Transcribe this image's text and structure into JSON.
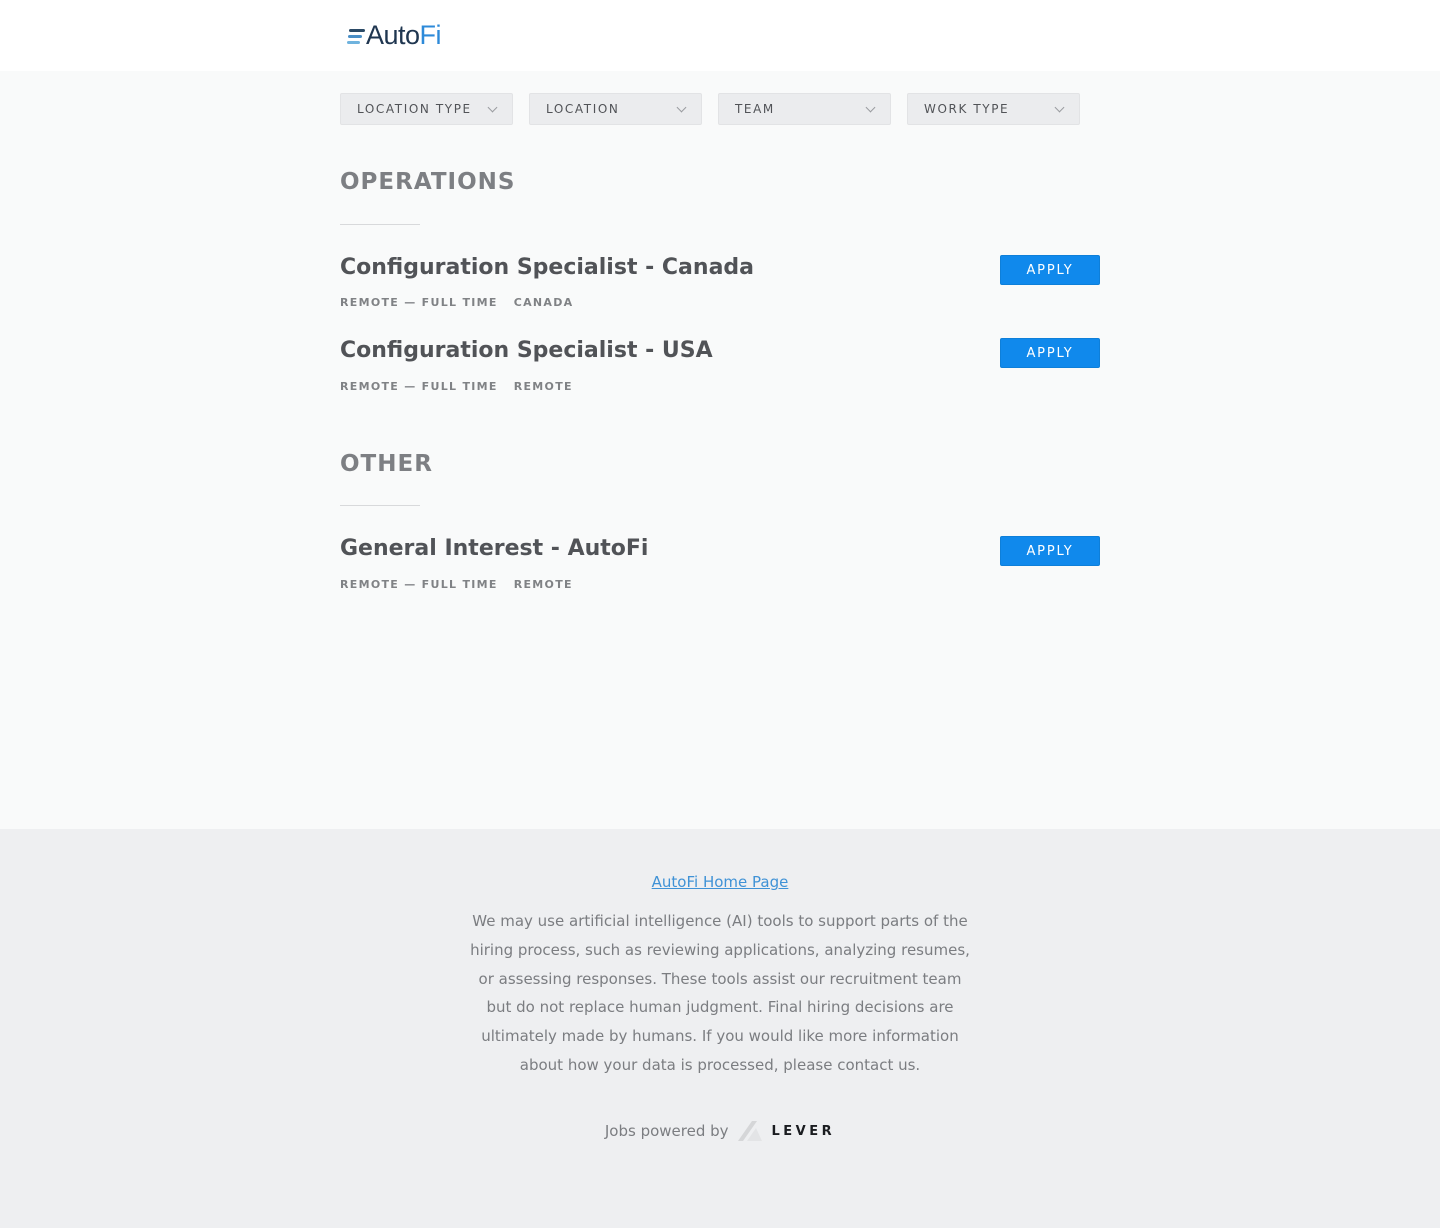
{
  "header": {
    "logo_part1": "Auto",
    "logo_part2": "Fi"
  },
  "filters": [
    {
      "label": "LOCATION TYPE"
    },
    {
      "label": "LOCATION"
    },
    {
      "label": "TEAM"
    },
    {
      "label": "WORK TYPE"
    }
  ],
  "groups": [
    {
      "title": "OPERATIONS",
      "postings": [
        {
          "title": "Configuration Specialist - Canada",
          "commitment": "REMOTE — FULL TIME",
          "location": "CANADA",
          "apply_label": "APPLY"
        },
        {
          "title": "Configuration Specialist - USA",
          "commitment": "REMOTE — FULL TIME",
          "location": "REMOTE",
          "apply_label": "APPLY"
        }
      ]
    },
    {
      "title": "OTHER",
      "postings": [
        {
          "title": "General Interest - AutoFi",
          "commitment": "REMOTE — FULL TIME",
          "location": "REMOTE",
          "apply_label": "APPLY"
        }
      ]
    }
  ],
  "footer": {
    "home_link": "AutoFi Home Page",
    "disclaimer": "We may use artificial intelligence (AI) tools to support parts of the hiring process, such as reviewing applications, analyzing resumes, or assessing responses. These tools assist our recruitment team but do not replace human judgment. Final hiring decisions are ultimately made by humans. If you would like more information about how your data is processed, please contact us.",
    "powered_by": "Jobs powered by",
    "lever_word": "LEVER"
  },
  "colors": {
    "accent": "#1089ec",
    "link": "#3f92d6",
    "page_bg": "#f9fafa",
    "footer_bg": "#eeeff1"
  }
}
